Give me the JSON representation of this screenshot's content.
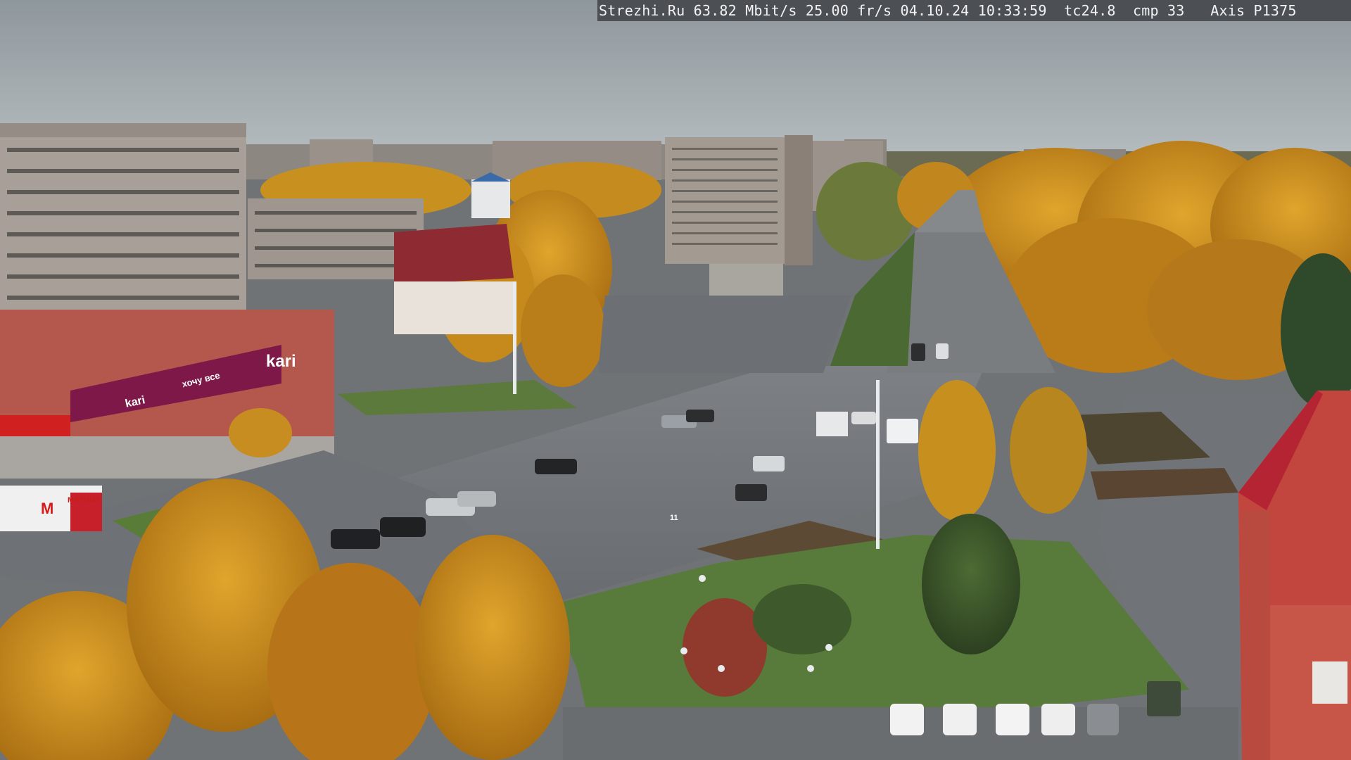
{
  "osd": {
    "site": "Strezhi.Ru",
    "bitrate": "63.82 Mbit/s",
    "framerate": "25.00 fr/s",
    "date": "04.10.24",
    "time": "10:33:59",
    "tc": "tc24.8",
    "cmp": "cmp 33",
    "camera": "Axis P1375"
  },
  "signs": {
    "kari_main": "kari",
    "kari_small": "kari",
    "shop_label": "хочу все",
    "truck_logo": "М",
    "truck_text": "МАГНИТ",
    "road_sign": "11"
  },
  "colors": {
    "sky": "#9aa3a8",
    "foliage": "#c98b1f",
    "asphalt": "#6e7276",
    "grass": "#587a3a",
    "kari_brand": "#7e1848",
    "osd_bg": "#464a4e"
  }
}
